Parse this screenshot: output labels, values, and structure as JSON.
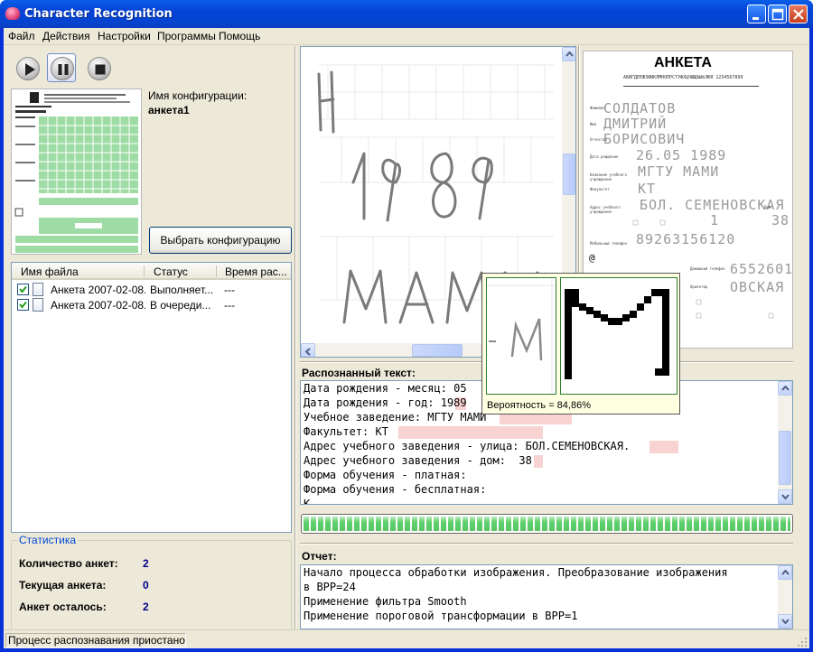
{
  "window": {
    "title": "Character Recognition"
  },
  "menu": [
    "Файл",
    "Действия",
    "Настройки",
    "Программы",
    "Помощь"
  ],
  "toolbar": [
    {
      "icon": "play-icon",
      "active": false
    },
    {
      "icon": "pause-icon",
      "active": true
    },
    {
      "icon": "stop-icon",
      "active": false
    }
  ],
  "config": {
    "label": "Имя конфигурации:",
    "name": "анкета1",
    "select_button": "Выбрать конфигурацию"
  },
  "file_list": {
    "columns": [
      "Имя файла",
      "Статус",
      "Время рас..."
    ],
    "rows": [
      {
        "checked": true,
        "name": "Анкета 2007-02-08...",
        "status": "Выполняет...",
        "time": "---"
      },
      {
        "checked": true,
        "name": "Анкета 2007-02-08...",
        "status": "В очереди...",
        "time": "---"
      }
    ]
  },
  "stats": {
    "title": "Статистика",
    "items": [
      {
        "label": "Количество анкет:",
        "value": "2"
      },
      {
        "label": "Текущая анкета:",
        "value": "0"
      },
      {
        "label": "Анкет осталось:",
        "value": "2"
      }
    ]
  },
  "scan": {
    "fragments": [
      "Н",
      "1989",
      "МАМИ"
    ]
  },
  "form_preview": {
    "title": "АНКЕТА",
    "small_header": "АБВГДЕЁЖЗИЙКЛМНОПРСТУФХЦЧШЩЪЫЬЭЮЯ  1234567890",
    "fields": [
      {
        "label": "Фамилия",
        "value": "СОЛДАТОВ"
      },
      {
        "label": "Имя",
        "value": "ДМИТРИЙ"
      },
      {
        "label": "Отчество",
        "value": "БОРИСОВИЧ"
      },
      {
        "label": "Дата рождения",
        "value": "26.05 1989"
      },
      {
        "label": "Название учебного учреждения",
        "value": "МГТУ МАМИ"
      },
      {
        "label": "Факультет",
        "value": "КТ"
      },
      {
        "label": "Адрес учебного учреждения",
        "value": "БОЛ. СЕМЕНОВСКАЯ"
      },
      {
        "label": "Дом",
        "value": "38"
      },
      {
        "label": "Мобильный телефон",
        "value": "89263156120"
      },
      {
        "label": "Домашний телефон",
        "value": "6552601"
      },
      {
        "label": "Ориентир",
        "value": "ОВСКАЯ"
      }
    ],
    "course_value": "1",
    "at_sign": "@"
  },
  "recognized": {
    "title": "Распознанный текст:",
    "lines": [
      "Дата рождения - месяц: 05",
      "Дата рождения - год: 1989",
      "Учебное заведение: МГТУ МАМИ",
      "Факультет: КТ",
      "Адрес учебного заведения - улица: БОЛ.СЕМЕНОВСКАЯ.",
      "Адрес учебного заведения - дом:  38",
      "Форма обучения - платная:",
      "Форма обучения - бесплатная:",
      "К..."
    ]
  },
  "progress": {
    "value": 1.0
  },
  "popup": {
    "probability_label": "Вероятность = 84,86%"
  },
  "report": {
    "title": "Отчет:",
    "lines": [
      "Начало процесса обработки изображения. Преобразование изображения",
      "в BPP=24",
      "Применение фильтра Smooth",
      "Применение пороговой трансформации в BPP=1"
    ]
  },
  "status": {
    "text": "Процесс распознавания приостановлен"
  },
  "colors": {
    "titlebar": "#0545d0",
    "face": "#ece9d8",
    "highlight": "#f9d2d2",
    "progress": "#5dd06a",
    "stat_value": "#00008b",
    "group_title": "#0046d5"
  }
}
